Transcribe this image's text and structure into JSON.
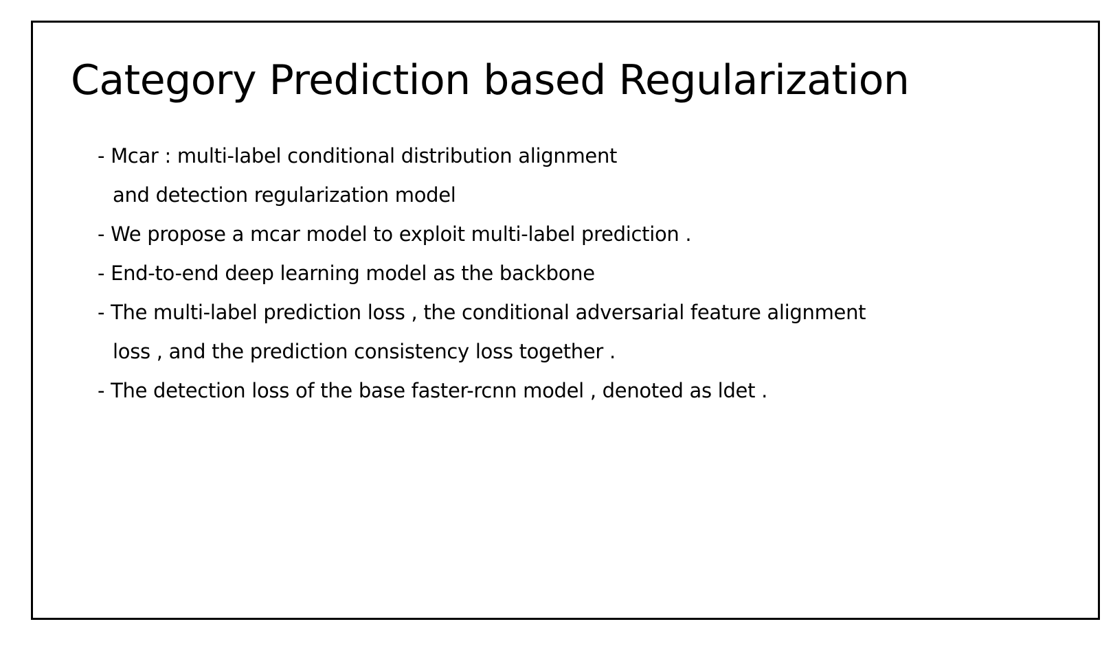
{
  "slide": {
    "title": "Category Prediction based Regularization",
    "lines": [
      "- Mcar : multi-label conditional distribution alignment",
      "and detection regularization model",
      "- We propose a mcar model to exploit multi-label prediction .",
      "- End-to-end deep learning model as the backbone",
      "- The multi-label prediction loss , the conditional adversarial feature alignment",
      "loss , and the prediction consistency loss together .",
      "- The detection loss of the base faster-rcnn model , denoted as ldet ."
    ]
  }
}
